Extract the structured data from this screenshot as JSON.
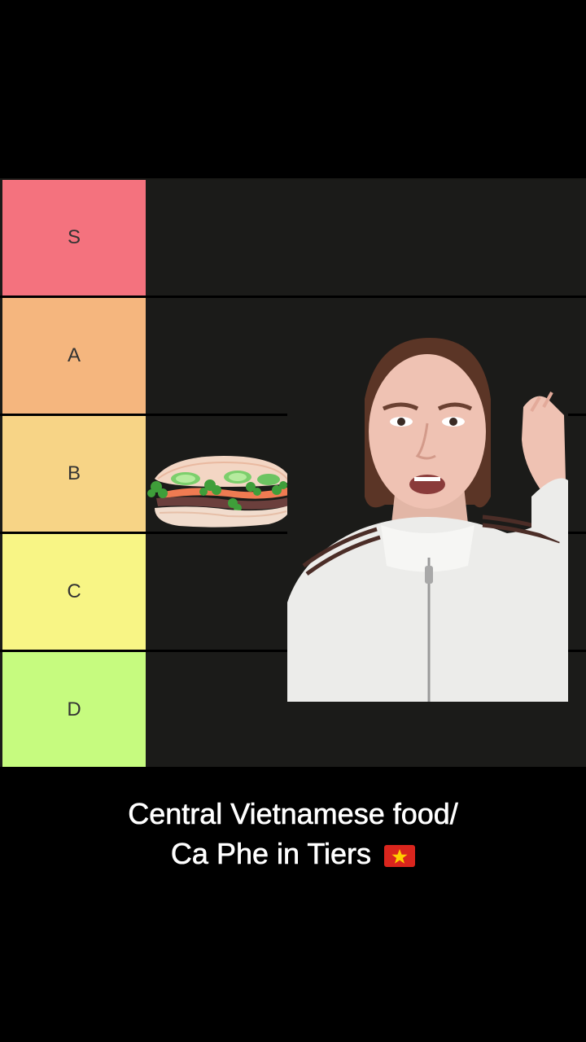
{
  "tiers": [
    {
      "label": "S",
      "color": "#f4727e"
    },
    {
      "label": "A",
      "color": "#f5b67e"
    },
    {
      "label": "B",
      "color": "#f7d486"
    },
    {
      "label": "C",
      "color": "#f8f585"
    },
    {
      "label": "D",
      "color": "#c6fb7f"
    }
  ],
  "placed_items": [
    {
      "tier": "B",
      "item_icon": "banh-mi-sandwich-icon"
    }
  ],
  "caption": {
    "line1": "Central Vietnamese food/",
    "line2": "Ca Phe in Tiers",
    "flag_icon": "vietnam-flag-icon"
  }
}
